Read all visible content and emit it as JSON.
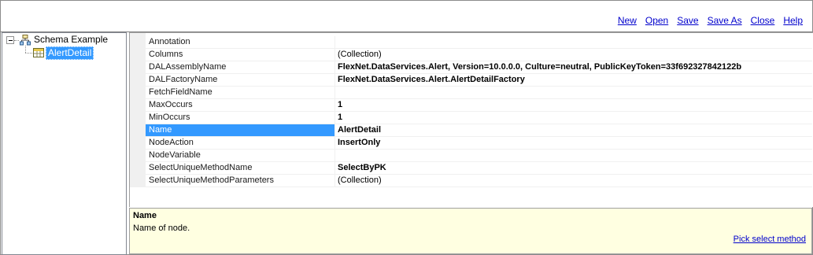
{
  "toolbar": {
    "links": [
      "New",
      "Open",
      "Save",
      "Save As",
      "Close",
      "Help"
    ]
  },
  "tree": {
    "root": {
      "label": "Schema Example",
      "icon": "schema-icon",
      "expanded": true
    },
    "child": {
      "label": "AlertDetail",
      "icon": "table-icon",
      "selected": true
    }
  },
  "properties": [
    {
      "name": "Annotation",
      "value": "",
      "bold": false
    },
    {
      "name": "Columns",
      "value": "(Collection)",
      "bold": false
    },
    {
      "name": "DALAssemblyName",
      "value": "FlexNet.DataServices.Alert, Version=10.0.0.0, Culture=neutral, PublicKeyToken=33f692327842122b",
      "bold": true
    },
    {
      "name": "DALFactoryName",
      "value": "FlexNet.DataServices.Alert.AlertDetailFactory",
      "bold": true
    },
    {
      "name": "FetchFieldName",
      "value": "",
      "bold": false
    },
    {
      "name": "MaxOccurs",
      "value": "1",
      "bold": true
    },
    {
      "name": "MinOccurs",
      "value": "1",
      "bold": true
    },
    {
      "name": "Name",
      "value": "AlertDetail",
      "bold": true,
      "selected": true
    },
    {
      "name": "NodeAction",
      "value": "InsertOnly",
      "bold": true
    },
    {
      "name": "NodeVariable",
      "value": "",
      "bold": false
    },
    {
      "name": "SelectUniqueMethodName",
      "value": "SelectByPK",
      "bold": true
    },
    {
      "name": "SelectUniqueMethodParameters",
      "value": "(Collection)",
      "bold": false
    }
  ],
  "description": {
    "title": "Name",
    "text": "Name of node.",
    "command": "Pick select method"
  },
  "colors": {
    "selection": "#3399ff",
    "link": "#0000cc",
    "description_bg": "#ffffe1"
  }
}
